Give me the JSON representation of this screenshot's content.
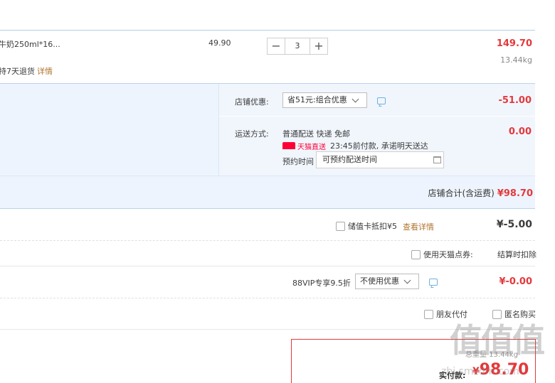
{
  "item": {
    "name": "牛奶250ml*16...",
    "return_policy": "持7天退货",
    "return_link": "详情",
    "unit_price": "49.90",
    "qty_minus": "−",
    "qty_value": "3",
    "qty_plus": "+",
    "subtotal": "149.70",
    "weight": "13.44kg"
  },
  "promo": {
    "store_discount_label": "店铺优惠:",
    "store_discount_select": "省51元:组合优惠",
    "store_discount_amount": "-51.00",
    "shipping_label": "运送方式:",
    "shipping_method": "普通配送 快递 免邮",
    "tmall_direct": "天猫直送",
    "delivery_promise": "23:45前付款, 承诺明天送达",
    "shipping_amount": "0.00",
    "reserve_label": "预约时间",
    "reserve_placeholder": "可预约配送时间"
  },
  "store_total": {
    "label": "店铺合计(含运费)",
    "amount": "¥98.70"
  },
  "stored_card": {
    "label": "储值卡抵扣¥5",
    "link": "查看详情",
    "amount": "¥-5.00"
  },
  "tmall_points": {
    "label": "使用天猫点券:",
    "value": "结算时扣除"
  },
  "vip": {
    "label": "88VIP专享9.5折",
    "select": "不使用优惠",
    "amount": "¥-0.00"
  },
  "options": {
    "friend_pay": "朋友代付",
    "anonymous": "匿名购买"
  },
  "payment": {
    "label": "实付款:",
    "amount": "98.70",
    "currency": "¥",
    "weight_text": "总重量 13.44kg"
  },
  "watermark": {
    "logo": "值值值",
    "url": "zhi.smzdm.com"
  },
  "colors": {
    "accent_red": "#e4393c",
    "promo_bg": "#edf4fd",
    "link_brown": "#b0752f",
    "tmall_red": "#ff0036"
  }
}
